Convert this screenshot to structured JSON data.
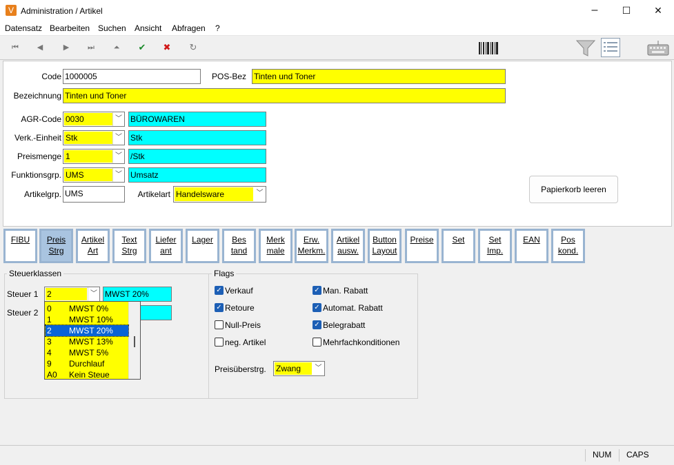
{
  "window": {
    "title": "Administration / Artikel",
    "icon_letter": "V",
    "minimize": "–",
    "maximize": "☐",
    "close": "✕"
  },
  "menu": [
    "Datensatz",
    "Bearbeiten",
    "Suchen",
    "Ansicht",
    "Abfragen",
    "?"
  ],
  "toolbar": {
    "first": "⏮",
    "prev": "◀",
    "next": "▶",
    "last": "⏭",
    "up": "⏶",
    "ok": "✔",
    "cancel": "✖",
    "refresh": "↻"
  },
  "form": {
    "code_label": "Code",
    "code_value": "1000005",
    "posbez_label": "POS-Bez",
    "posbez_value": "Tinten und Toner",
    "bezeichnung_label": "Bezeichnung",
    "bezeichnung_value": "Tinten und Toner",
    "agr_label": "AGR-Code",
    "agr_value": "0030",
    "agr_desc": "BÜROWAREN",
    "verk_label": "Verk.-Einheit",
    "verk_value": "Stk",
    "verk_desc": "Stk",
    "preismenge_label": "Preismenge",
    "preismenge_value": "1",
    "preismenge_desc": "/Stk",
    "funk_label": "Funktionsgrp.",
    "funk_value": "UMS",
    "funk_desc": "Umsatz",
    "artikelgrp_label": "Artikelgrp.",
    "artikelgrp_value": "UMS",
    "artikelart_label": "Artikelart",
    "artikelart_value": "Handelsware",
    "papierkorb": "Papierkorb leeren"
  },
  "tabs": [
    [
      "FIBU",
      ""
    ],
    [
      "Preis",
      "Strg"
    ],
    [
      "Artikel",
      "Art"
    ],
    [
      "Text",
      "Strg"
    ],
    [
      "Liefer",
      "ant"
    ],
    [
      "Lager",
      ""
    ],
    [
      "Bes",
      "tand"
    ],
    [
      "Merk",
      "male"
    ],
    [
      "Erw.",
      "Merkm."
    ],
    [
      "Artikel",
      "ausw."
    ],
    [
      "Button",
      "Layout"
    ],
    [
      "Preise",
      ""
    ],
    [
      "Set",
      ""
    ],
    [
      "Set",
      "Imp."
    ],
    [
      "EAN",
      ""
    ],
    [
      "Pos",
      "kond."
    ]
  ],
  "steuer": {
    "group_title": "Steuerklassen",
    "steuer1_label": "Steuer 1",
    "steuer1_value": "2",
    "steuer1_desc": "MWST 20%",
    "steuer2_label": "Steuer 2",
    "options": [
      [
        "0",
        "MWST 0%"
      ],
      [
        "1",
        "MWST 10%"
      ],
      [
        "2",
        "MWST 20%"
      ],
      [
        "3",
        "MWST 13%"
      ],
      [
        "4",
        "MWST 5%"
      ],
      [
        "9",
        "Durchlauf"
      ],
      [
        "A0",
        "Kein Steue"
      ]
    ]
  },
  "flags": {
    "group_title": "Flags",
    "items": [
      {
        "label": "Verkauf",
        "checked": true
      },
      {
        "label": "Retoure",
        "checked": true
      },
      {
        "label": "Null-Preis",
        "checked": false
      },
      {
        "label": "neg. Artikel",
        "checked": false
      },
      {
        "label": "Man. Rabatt",
        "checked": true
      },
      {
        "label": "Automat. Rabatt",
        "checked": true
      },
      {
        "label": "Belegrabatt",
        "checked": true
      },
      {
        "label": "Mehrfachkonditionen",
        "checked": false
      }
    ],
    "preisueb_label": "Preisüberstrg.",
    "preisueb_value": "Zwang"
  },
  "status": {
    "num": "NUM",
    "caps": "CAPS"
  },
  "colors": {
    "field_yellow": "#ffff00",
    "field_cyan": "#00ffff",
    "selection": "#0a64d6",
    "tab_border": "#99b4d1"
  }
}
